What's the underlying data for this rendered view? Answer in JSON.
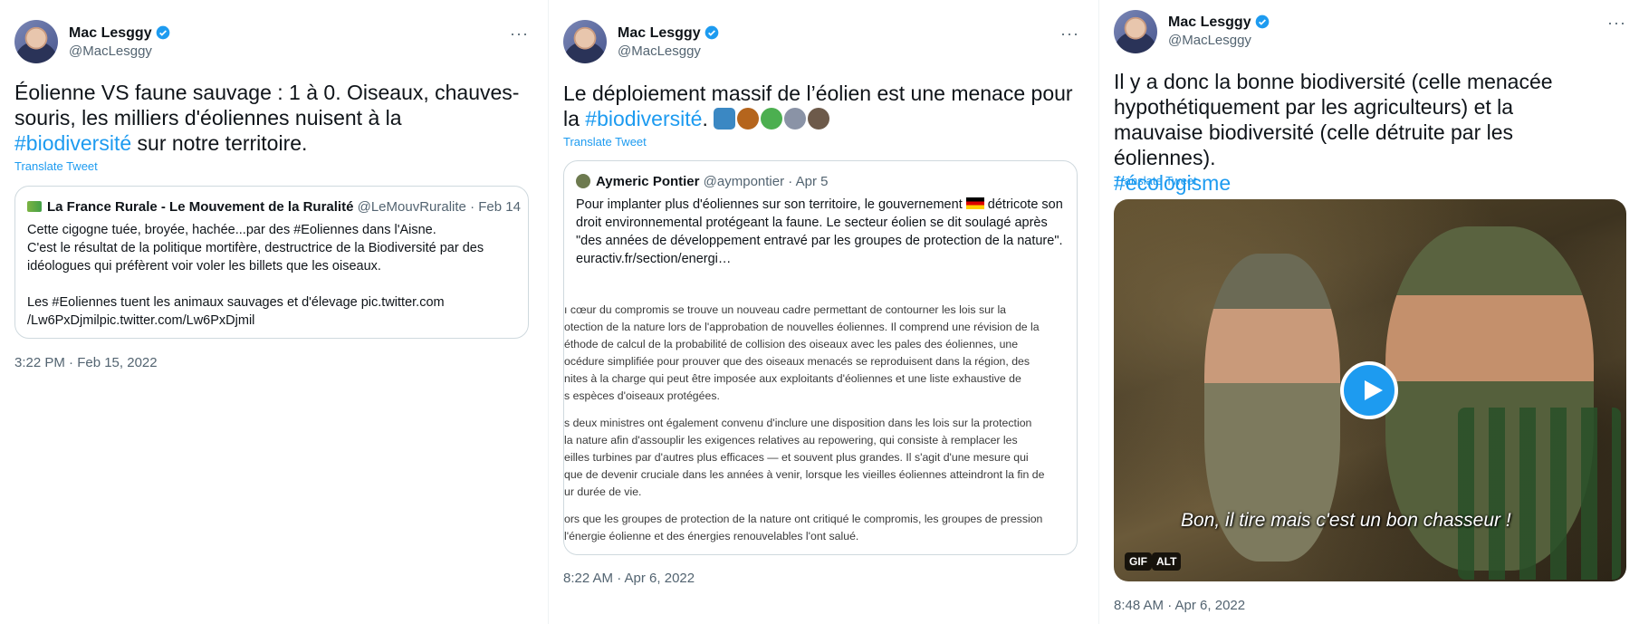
{
  "tweets": [
    {
      "author": {
        "name": "Mac Lesggy",
        "handle": "@MacLesggy",
        "verified_icon": "verified-badge-icon"
      },
      "more_icon": "···",
      "text_before": "Éolienne VS faune sauvage : 1 à 0. Oiseaux, chauves-souris, les milliers d'éoliennes nuisent à la ",
      "hashtag": "#biodiversité",
      "text_after": " sur notre territoire.",
      "translate": "Translate Tweet",
      "quote": {
        "name": "La France Rurale - Le Mouvement de la Ruralité",
        "handle": "@LeMouvRuralite",
        "date": "Feb 14",
        "lines": [
          "Cette cigogne tuée, broyée, hachée...par des #Eoliennes dans l'Aisne.",
          "C'est le résultat de la politique mortifère, destructrice de la Biodiversité par des idéologues qui préfèrent voir voler les billets que les oiseaux.",
          "Les #Eoliennes tuent les animaux sauvages et d'élevage pic.twitter.com /Lw6PxDjmilpic.twitter.com/Lw6PxDjmil"
        ]
      },
      "timestamp": "3:22 PM · Feb 15, 2022"
    },
    {
      "author": {
        "name": "Mac Lesggy",
        "handle": "@MacLesggy"
      },
      "more_icon": "···",
      "text_before": "Le déploiement massif de l’éolien est une menace pour la ",
      "hashtag": "#biodiversité",
      "text_after": ".",
      "emojis": [
        "arrow-down-icon",
        "boar-icon",
        "beetle-icon",
        "bat-icon",
        "eagle-icon"
      ],
      "translate": "Translate Tweet",
      "quote": {
        "name": "Aymeric Pontier",
        "handle": "@aympontier",
        "date": "Apr 5",
        "text_a": "Pour implanter plus d'éoliennes sur son territoire, le gouvernement",
        "text_b": "détricote son droit environnemental protégeant la faune. Le secteur éolien se dit soulagé après \"des années de développement entravé par les groupes de protection de la nature\".",
        "link": "euractiv.fr/section/energi…",
        "image_paragraphs": [
          [
            "ı cœur du compromis se trouve un nouveau cadre permettant de contourner les lois sur la",
            "otection de la nature lors de l'approbation de nouvelles éoliennes. Il comprend une révision de la",
            "éthode de calcul de la probabilité de collision des oiseaux avec les pales des éoliennes, une",
            "océdure simplifiée pour prouver que des oiseaux menacés se reproduisent dans la région, des",
            "nites à la charge qui peut être imposée aux exploitants d'éoliennes et une liste exhaustive de",
            "s espèces d'oiseaux protégées."
          ],
          [
            "s deux ministres ont également convenu d'inclure une disposition dans les lois sur la protection",
            "la nature afin d'assouplir les exigences relatives au repowering, qui consiste à remplacer les",
            "eilles turbines par d'autres plus efficaces — et souvent plus grandes. Il s'agit d'une mesure qui",
            "que de devenir cruciale dans les années à venir, lorsque les vieilles éoliennes atteindront la fin de",
            "ur durée de vie."
          ],
          [
            "ors que les groupes de protection de la nature ont critiqué le compromis, les groupes de pression",
            "l'énergie éolienne et des énergies renouvelables l'ont salué."
          ]
        ]
      },
      "timestamp": "8:22 AM · Apr 6, 2022"
    },
    {
      "author": {
        "name": "Mac Lesggy",
        "handle": "@MacLesggy"
      },
      "more_icon": "···",
      "text_before": "Il y a donc la bonne biodiversité (celle menacée hypothétiquement par les agriculteurs) et la mauvaise biodiversité (celle détruite par les éoliennes).",
      "hashtag": "#écologisme",
      "translate": "Translate Tweet",
      "media": {
        "subtitle": "Bon, il tire mais c'est un bon chasseur !",
        "badge_gif": "GIF",
        "badge_alt": "ALT",
        "play_icon": "play-icon"
      },
      "timestamp": "8:48 AM · Apr 6, 2022"
    }
  ],
  "colors": {
    "accent": "#1d9bf0",
    "secondary_text": "#536471",
    "border": "#cfd9de"
  }
}
